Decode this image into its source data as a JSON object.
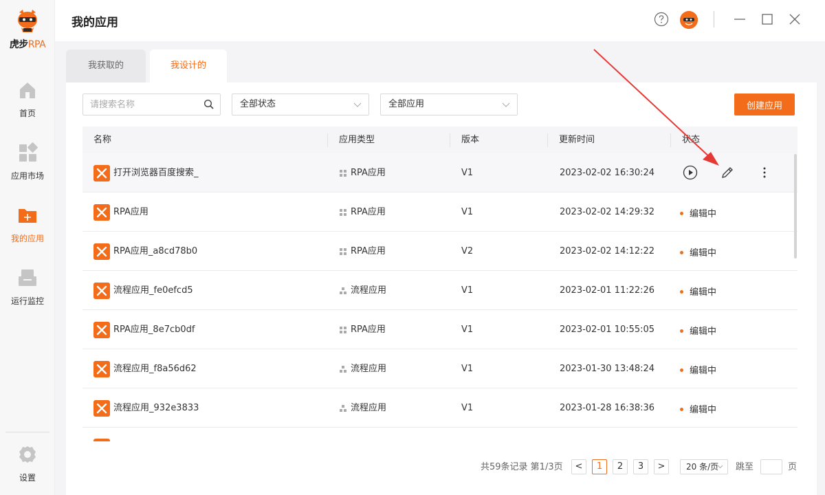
{
  "app": {
    "brand_main": "虎步",
    "brand_rpa": "RPA"
  },
  "sidebar": {
    "items": [
      {
        "label": "首页",
        "icon": "home-icon"
      },
      {
        "label": "应用市场",
        "icon": "app-market-icon"
      },
      {
        "label": "我的应用",
        "icon": "folder-add-icon",
        "active": true
      },
      {
        "label": "运行监控",
        "icon": "monitor-icon"
      }
    ],
    "settings_label": "设置"
  },
  "header": {
    "title": "我的应用"
  },
  "tabs": [
    {
      "label": "我获取的",
      "active": false
    },
    {
      "label": "我设计的",
      "active": true
    }
  ],
  "filters": {
    "search_placeholder": "请搜索名称",
    "status_select": "全部状态",
    "app_select": "全部应用",
    "create_label": "创建应用"
  },
  "table": {
    "columns": [
      "名称",
      "应用类型",
      "版本",
      "更新时间",
      "状态"
    ],
    "rows": [
      {
        "name": "打开浏览器百度搜索_",
        "type": "RPA应用",
        "version": "V1",
        "updated": "2023-02-02 16:30:24",
        "status": ""
      },
      {
        "name": "RPA应用",
        "type": "RPA应用",
        "version": "V1",
        "updated": "2023-02-02 14:29:32",
        "status": "编辑中"
      },
      {
        "name": "RPA应用_a8cd78b0",
        "type": "RPA应用",
        "version": "V2",
        "updated": "2023-02-02 14:12:22",
        "status": "编辑中"
      },
      {
        "name": "流程应用_fe0efcd5",
        "type": "流程应用",
        "version": "V1",
        "updated": "2023-02-01 11:22:26",
        "status": "编辑中"
      },
      {
        "name": "RPA应用_8e7cb0df",
        "type": "RPA应用",
        "version": "V1",
        "updated": "2023-02-01 10:55:05",
        "status": "编辑中"
      },
      {
        "name": "流程应用_f8a56d62",
        "type": "流程应用",
        "version": "V1",
        "updated": "2023-01-30 13:48:24",
        "status": "编辑中"
      },
      {
        "name": "流程应用_932e3833",
        "type": "流程应用",
        "version": "V1",
        "updated": "2023-01-28 16:38:36",
        "status": "编辑中"
      }
    ]
  },
  "pagination": {
    "summary": "共59条记录 第1/3页",
    "prev": "<",
    "next": ">",
    "pages": [
      "1",
      "2",
      "3"
    ],
    "current": "1",
    "page_size": "20 条/页",
    "jump_label": "跳至",
    "page_suffix": "页"
  },
  "colors": {
    "accent": "#f26c1a",
    "annotation": "#e53935"
  }
}
